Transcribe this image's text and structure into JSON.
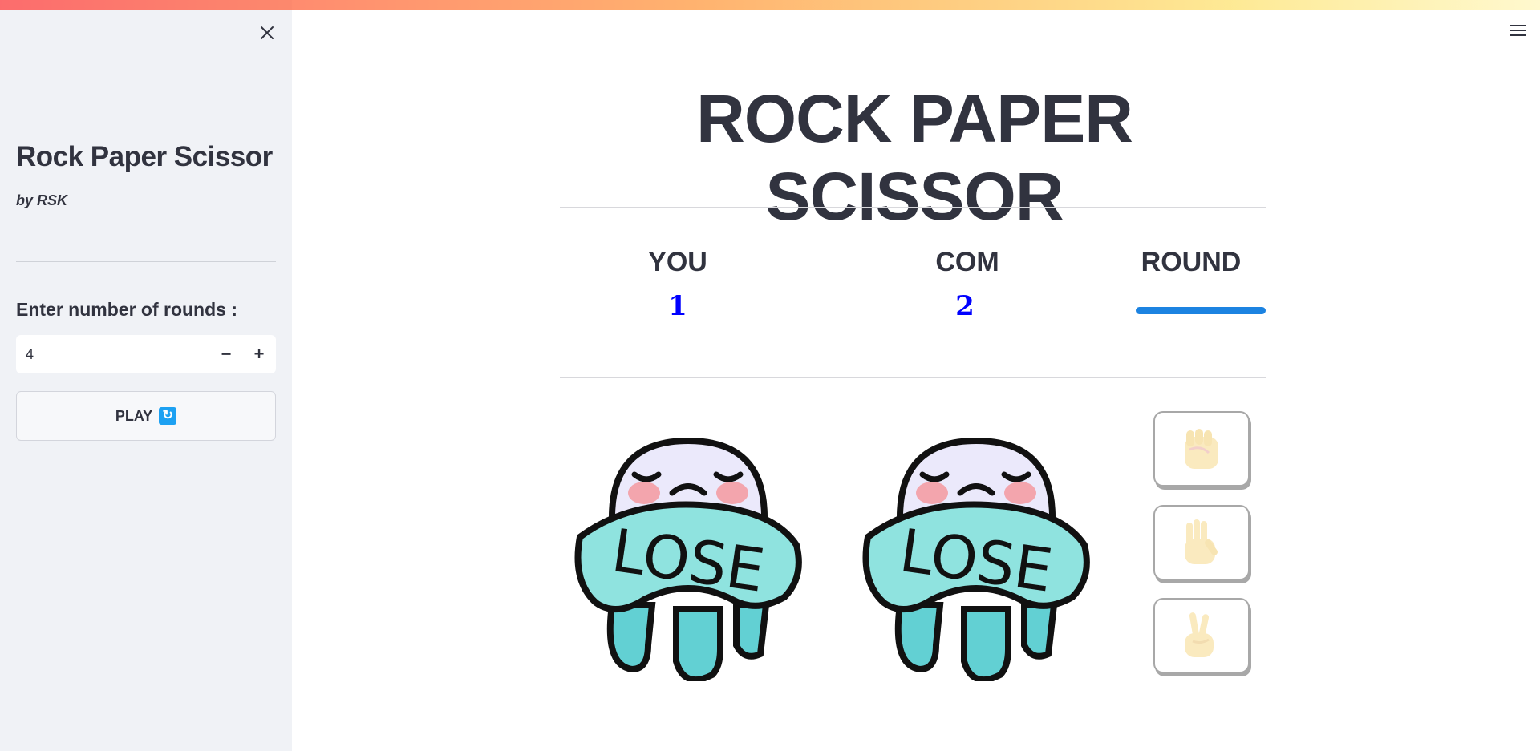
{
  "sidebar": {
    "title": "Rock Paper Scissor",
    "byline": "by RSK",
    "rounds_label": "Enter number of rounds :",
    "rounds_value": "4",
    "minus_label": "−",
    "plus_label": "+",
    "play_label": "PLAY",
    "play_icon": "refresh-icon"
  },
  "main": {
    "title": "ROCK PAPER SCISSOR",
    "you_label": "YOU",
    "you_score": "1",
    "com_label": "COM",
    "com_score": "2",
    "round_label": "ROUND",
    "round_progress": 1.0,
    "player_result_text": "LOSE",
    "com_result_text": "LOSE",
    "choices": [
      {
        "name": "rock",
        "icon": "fist-icon"
      },
      {
        "name": "paper",
        "icon": "open-hand-icon"
      },
      {
        "name": "scissor",
        "icon": "victory-hand-icon"
      }
    ]
  },
  "colors": {
    "accent": "#1c83e1",
    "score": "#0000ff",
    "sidebar_bg": "#f0f2f6",
    "lose_banner": "#8fe3df"
  }
}
